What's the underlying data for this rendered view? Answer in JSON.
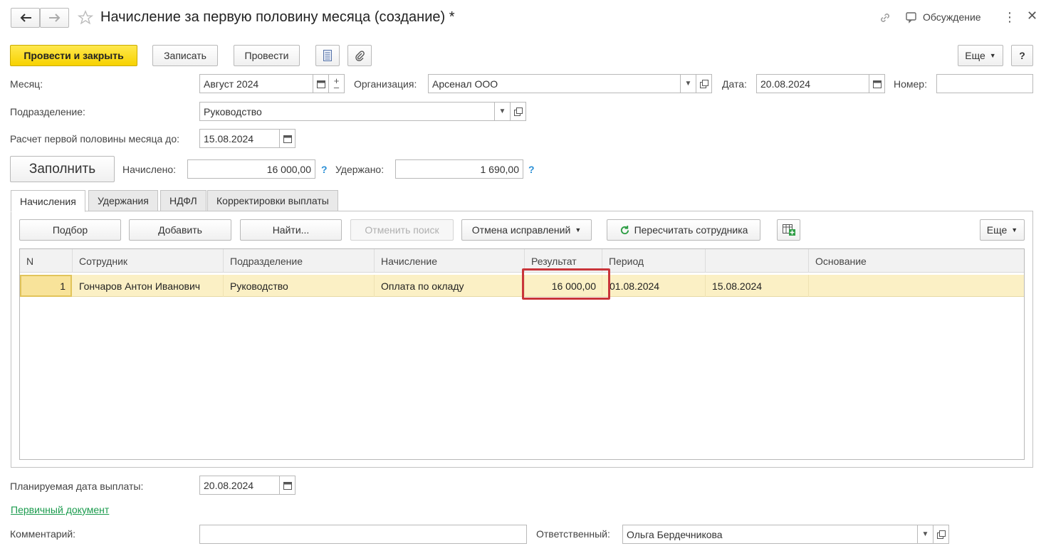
{
  "header": {
    "title": "Начисление за первую половину месяца (создание) *",
    "discussion": "Обсуждение"
  },
  "toolbar": {
    "post_close": "Провести и закрыть",
    "save": "Записать",
    "post": "Провести",
    "more": "Еще",
    "help": "?"
  },
  "form": {
    "month_label": "Месяц:",
    "month_value": "Август 2024",
    "org_label": "Организация:",
    "org_value": "Арсенал ООО",
    "date_label": "Дата:",
    "date_value": "20.08.2024",
    "number_label": "Номер:",
    "number_value": "",
    "dept_label": "Подразделение:",
    "dept_value": "Руководство",
    "calc_until_label": "Расчет первой половины месяца до:",
    "calc_until_value": "15.08.2024",
    "fill": "Заполнить",
    "accrued_label": "Начислено:",
    "accrued_value": "16 000,00",
    "withheld_label": "Удержано:",
    "withheld_value": "1 690,00"
  },
  "tabs": [
    {
      "label": "Начисления"
    },
    {
      "label": "Удержания"
    },
    {
      "label": "НДФЛ"
    },
    {
      "label": "Корректировки выплаты"
    }
  ],
  "table_toolbar": {
    "pick": "Подбор",
    "add": "Добавить",
    "find": "Найти...",
    "cancel_search": "Отменить поиск",
    "cancel_fixes": "Отмена исправлений",
    "recalc": "Пересчитать сотрудника",
    "more": "Еще"
  },
  "table": {
    "columns": [
      "N",
      "Сотрудник",
      "Подразделение",
      "Начисление",
      "Результат",
      "Период",
      "",
      "Основание"
    ],
    "rows": [
      {
        "n": "1",
        "employee": "Гончаров Антон Иванович",
        "dept": "Руководство",
        "accrual": "Оплата по окладу",
        "result": "16 000,00",
        "period_from": "01.08.2024",
        "period_to": "15.08.2024",
        "basis": ""
      }
    ]
  },
  "footer": {
    "pay_date_label": "Планируемая дата выплаты:",
    "pay_date_value": "20.08.2024",
    "primary_doc": "Первичный документ",
    "comment_label": "Комментарий:",
    "comment_value": "",
    "responsible_label": "Ответственный:",
    "responsible_value": "Ольга Бердечникова"
  },
  "colors": {
    "primary_button": "#f7d200",
    "selected_row": "#fbf0c5",
    "highlight_box": "#c9353a",
    "link": "#1a9b4d"
  }
}
